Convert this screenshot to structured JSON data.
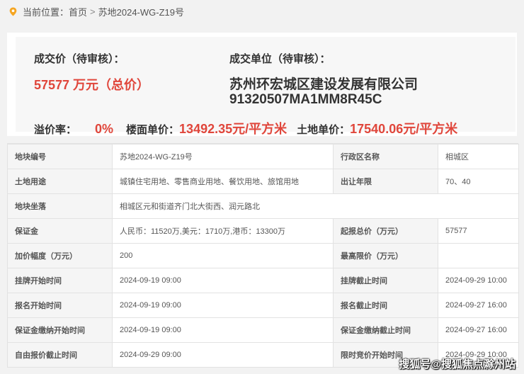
{
  "breadcrumb": {
    "prefix": "当前位置：",
    "home": "首页",
    "separator": ">",
    "current": "苏地2024-WG-Z19号",
    "icon": "location-pin-icon",
    "icon_color": "#f5a623"
  },
  "summary": {
    "price_label": "成交价（待审核）：",
    "price_value": "57577 万元（总价）",
    "buyer_label": "成交单位（待审核）：",
    "buyer_name": "苏州环宏城区建设发展有限公司",
    "buyer_code": "91320507MA1MM8R45C",
    "premium_label": "溢价率：",
    "premium_value": "0%",
    "floor_price_label": "楼面单价：",
    "floor_price_value": "13492.35元/平方米",
    "land_price_label": "土地单价：",
    "land_price_value": "17540.06元/平方米",
    "accent_color": "#e0463b"
  },
  "table": {
    "rows": [
      {
        "k1": "地块编号",
        "v1": "苏地2024-WG-Z19号",
        "k2": "行政区名称",
        "v2": "相城区"
      },
      {
        "k1": "土地用途",
        "v1": "城镇住宅用地、零售商业用地、餐饮用地、旅馆用地",
        "k2": "出让年限",
        "v2": "70、40"
      },
      {
        "k1": "地块坐落",
        "v1": "相城区元和街道齐门北大街西、润元路北"
      },
      {
        "k1": "保证金",
        "v1": "人民币：11520万,美元：1710万,港币：13300万",
        "k2": "起报总价（万元）",
        "v2": "57577"
      },
      {
        "k1": "加价幅度（万元）",
        "v1": "200",
        "k2": "最高限价（万元）",
        "v2": ""
      },
      {
        "k1": "挂牌开始时间",
        "v1": "2024-09-19 09:00",
        "k2": "挂牌截止时间",
        "v2": "2024-09-29 10:00"
      },
      {
        "k1": "报名开始时间",
        "v1": "2024-09-19 09:00",
        "k2": "报名截止时间",
        "v2": "2024-09-27 16:00"
      },
      {
        "k1": "保证金缴纳开始时间",
        "v1": "2024-09-19 09:00",
        "k2": "保证金缴纳截止时间",
        "v2": "2024-09-27 16:00"
      },
      {
        "k1": "自由报价截止时间",
        "v1": "2024-09-29 09:00",
        "k2": "限时竞价开始时间",
        "v2": "2024-09-29 10:00"
      }
    ]
  },
  "watermark": "搜狐号@搜狐焦点滁州站"
}
